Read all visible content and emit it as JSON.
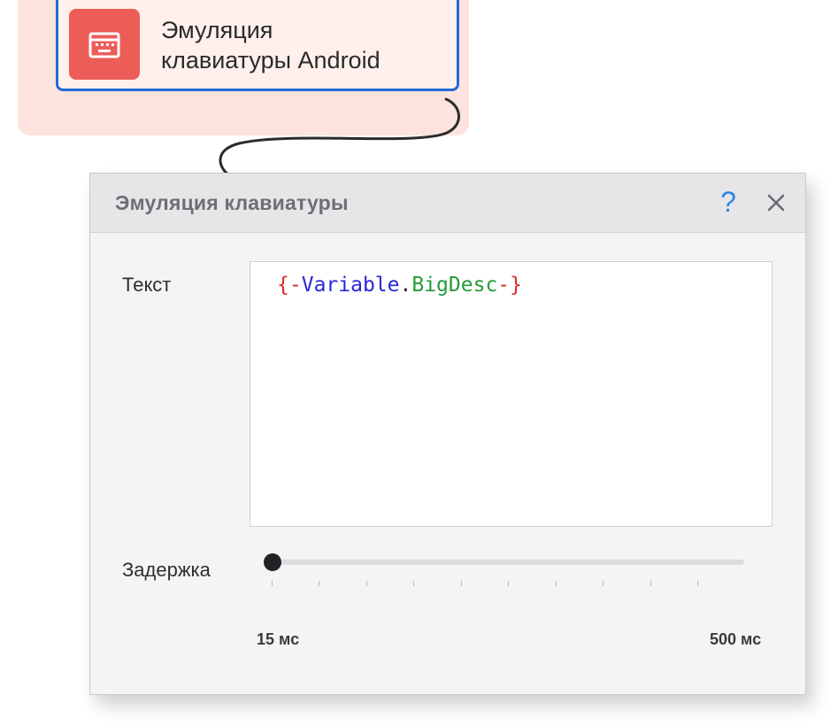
{
  "node": {
    "title": "Эмуляция\nклавиатуры Android",
    "icon": "keyboard-icon",
    "accent_color": "#ec5d58",
    "selected_border_color": "#1f6bd7"
  },
  "dialog": {
    "title": "Эмуляция клавиатуры",
    "help_label": "?",
    "close_icon": "close-icon",
    "text_label": "Текст",
    "text_value_tokens": [
      "{",
      "-",
      "Variable",
      ".",
      "BigDesc",
      "-",
      "}"
    ],
    "delay_label": "Задержка",
    "delay_min_label": "15 мс",
    "delay_max_label": "500 мс",
    "delay_value_fraction": 0.0
  }
}
